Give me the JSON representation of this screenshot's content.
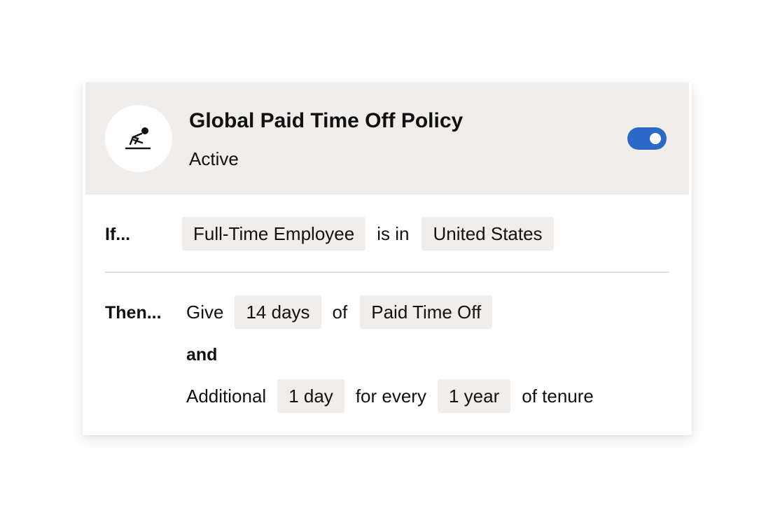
{
  "policy": {
    "title": "Global Paid Time Off Policy",
    "status": "Active",
    "icon": "vacation-person-icon",
    "toggle_on": true,
    "accent_color": "#2a6ac6",
    "header_bg": "#f0edea"
  },
  "condition": {
    "label": "If...",
    "subject": "Full-Time Employee",
    "operator": "is in",
    "value": "United States"
  },
  "action": {
    "label": "Then...",
    "give_word": "Give",
    "amount": "14 days",
    "of_word": "of",
    "type": "Paid Time Off",
    "and_word": "and",
    "additional_word": "Additional",
    "extra_amount": "1 day",
    "for_every_word": "for every",
    "period": "1 year",
    "suffix": "of tenure"
  }
}
